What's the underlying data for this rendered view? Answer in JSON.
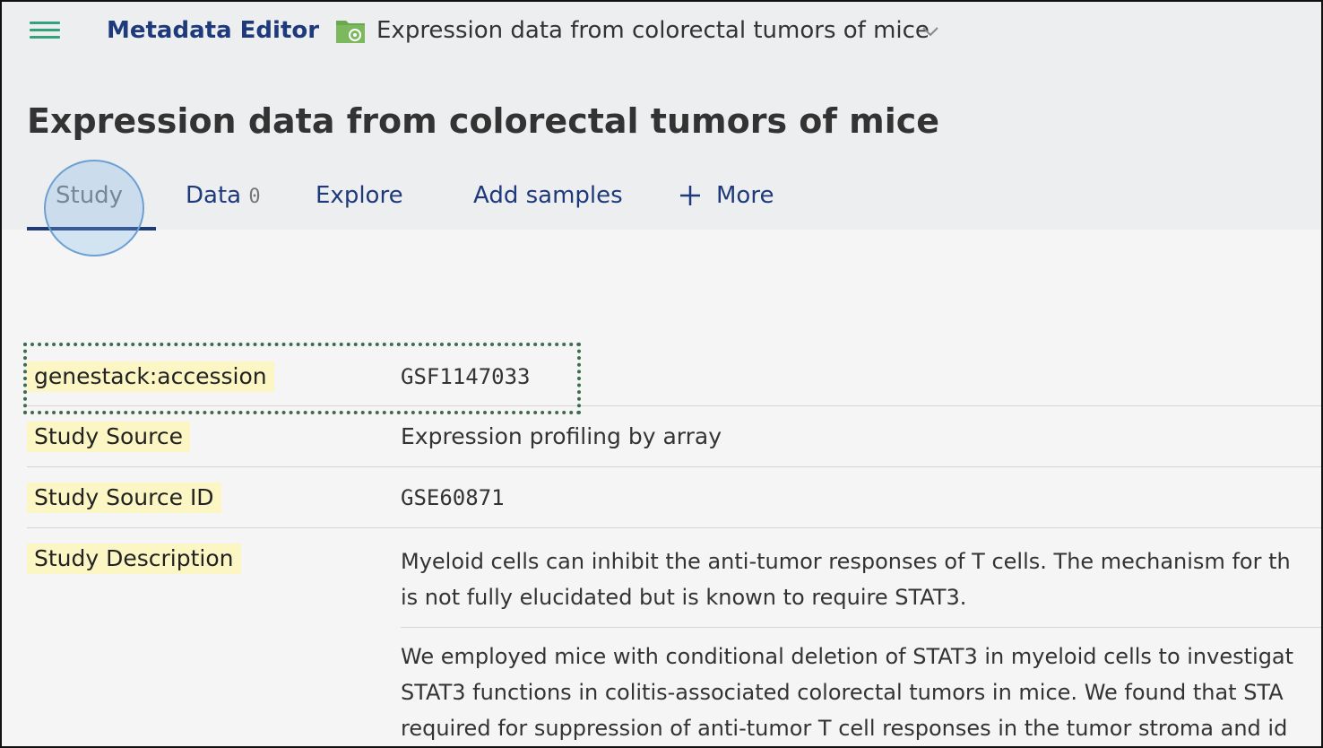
{
  "app": {
    "name": "Metadata Editor",
    "breadcrumb": "Expression data from colorectal tumors of mice"
  },
  "page": {
    "title": "Expression data from colorectal tumors of mice"
  },
  "tabs": [
    {
      "label": "Study",
      "active": true
    },
    {
      "label": "Data",
      "count": "0"
    },
    {
      "label": "Explore"
    },
    {
      "label": "Add samples"
    },
    {
      "label": "More"
    }
  ],
  "metadata": [
    {
      "key": "genestack:accession",
      "value": "GSF1147033"
    },
    {
      "key": "Study Source",
      "value": "Expression profiling by array"
    },
    {
      "key": "Study Source ID",
      "value": "GSE60871"
    },
    {
      "key": "Study Description",
      "paragraphs": [
        [
          "Myeloid cells can inhibit the anti-tumor responses of T cells. The mechanism for th",
          "is not fully elucidated but is known to require STAT3."
        ],
        [
          "We employed mice with conditional deletion of STAT3 in myeloid cells to investigat",
          "STAT3 functions in colitis-associated colorectal tumors in mice. We found that STA",
          "required for suppression of anti-tumor T cell responses in the tumor stroma and id"
        ]
      ]
    }
  ],
  "colors": {
    "accent": "#1f3a7a",
    "menu": "#35a27a",
    "key_highlight": "#fbf6c3",
    "folder": "#6aa84f"
  },
  "icons": [
    "menu-icon",
    "folder-icon",
    "chevron-down-icon",
    "plus-icon"
  ]
}
